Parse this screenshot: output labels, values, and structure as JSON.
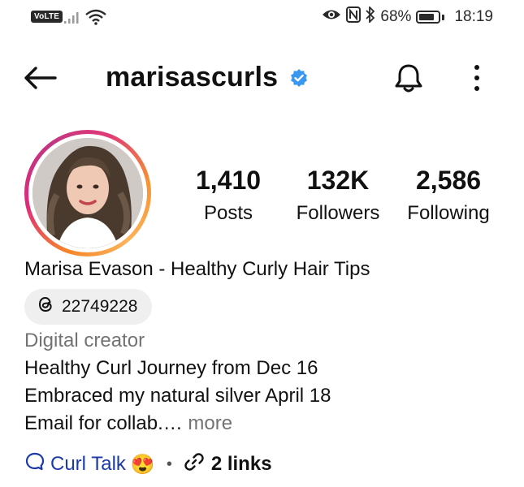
{
  "status_bar": {
    "network_badge": "VoLTE",
    "battery_percent": "68%",
    "battery_level": 0.68,
    "time": "18:19",
    "icons": [
      "signal-icon",
      "wifi-icon",
      "eye-icon",
      "nfc-icon",
      "bluetooth-icon",
      "battery-icon"
    ]
  },
  "header": {
    "username": "marisascurls",
    "verified": true,
    "accent_color": "#3897f0"
  },
  "stats": {
    "posts": {
      "value": "1,410",
      "label": "Posts"
    },
    "followers": {
      "value": "132K",
      "label": "Followers"
    },
    "following": {
      "value": "2,586",
      "label": "Following"
    }
  },
  "profile": {
    "full_name": "Marisa Evason - Healthy Curly Hair Tips",
    "threads_handle": "22749228",
    "category": "Digital creator",
    "bio_lines": [
      "Healthy Curl Journey from Dec 16",
      "Embraced my natural silver April 18",
      "Email for collab.…"
    ],
    "more_label": " more"
  },
  "links_row": {
    "community_name": "Curl Talk",
    "community_emoji": "😍",
    "separator": "•",
    "links_label": "2 links"
  }
}
